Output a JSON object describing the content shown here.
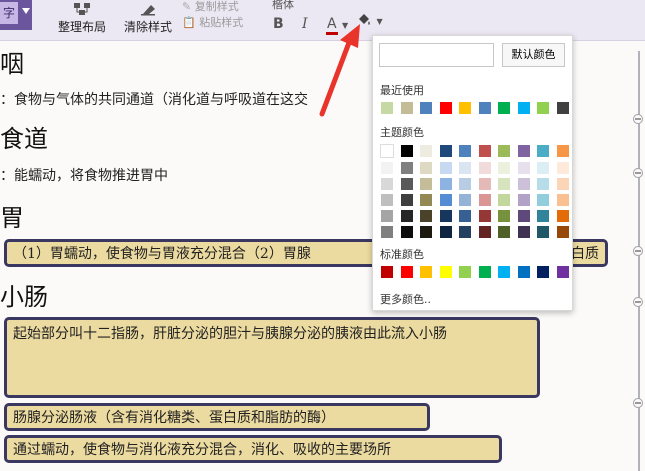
{
  "toolbar": {
    "cut_label": "字",
    "layout_button": "整理布局",
    "clear_style_button": "清除样式",
    "copy_style": "复制样式",
    "paste_style": "粘贴样式",
    "font_name": "楷体",
    "bold": "B",
    "italic": "I",
    "font_color": "A",
    "colors": {
      "purple": "#6b559c",
      "font_color_bar": "#c00000"
    }
  },
  "content": {
    "h1": "咽",
    "line1": "：食物与气体的共同通道（消化道与呼吸道在这交",
    "h2": "食道",
    "line2": "：能蠕动，将食物推进胃中",
    "h3": "胃",
    "box1_a": "（1）胃蠕动，使食物与胃液充分混合（2）胃腺",
    "box1_b": "白质",
    "h4": "小肠",
    "box2": "起始部分叫十二指肠，肝脏分泌的胆汁与胰腺分泌的胰液由此流入小肠",
    "box3": "肠腺分泌肠液（含有消化糖类、蛋白质和脂肪的酶）",
    "box4": "通过蠕动，使食物与消化液充分混合，消化、吸收的主要场所",
    "box_color": "#ecdba0",
    "box_border": "#3a3760"
  },
  "color_picker": {
    "hex_value": "",
    "default_button": "默认颜色",
    "recent_label": "最近使用",
    "theme_label": "主题颜色",
    "standard_label": "标准颜色",
    "more_colors": "更多颜色..",
    "recent": [
      "#c6d9a4",
      "#c4bc96",
      "#4f81bd",
      "#ff0000",
      "#ffc000",
      "#4f81bd",
      "#00b050",
      "#00b0f0",
      "#92d050",
      "#404040"
    ],
    "theme": [
      [
        "#ffffff",
        "#000000",
        "#eeece1",
        "#1f497d",
        "#4f81bd",
        "#c0504d",
        "#9bbb59",
        "#8064a2",
        "#4bacc6",
        "#f79646"
      ],
      [
        "#f2f2f2",
        "#7f7f7f",
        "#ddd9c3",
        "#c6d9f0",
        "#dbe5f1",
        "#f2dcdb",
        "#ebf1dd",
        "#e5e0ec",
        "#dbeef3",
        "#fdeada"
      ],
      [
        "#d8d8d8",
        "#595959",
        "#c4bd97",
        "#8db3e2",
        "#b8cce4",
        "#e5b9b7",
        "#d7e3bc",
        "#ccc1d9",
        "#b7dde8",
        "#fbd5b5"
      ],
      [
        "#bfbfbf",
        "#3f3f3f",
        "#938953",
        "#548dd4",
        "#95b3d7",
        "#d99694",
        "#c3d69b",
        "#b2a2c7",
        "#92cddc",
        "#fac08f"
      ],
      [
        "#a5a5a5",
        "#262626",
        "#494429",
        "#17365d",
        "#366092",
        "#953734",
        "#76923c",
        "#5f497a",
        "#31859b",
        "#e36c09"
      ],
      [
        "#7f7f7f",
        "#0c0c0c",
        "#1d1b10",
        "#0f243e",
        "#244061",
        "#632423",
        "#4f6128",
        "#3f3151",
        "#205867",
        "#974806"
      ]
    ],
    "standard": [
      "#c00000",
      "#ff0000",
      "#ffc000",
      "#ffff00",
      "#92d050",
      "#00b050",
      "#00b0f0",
      "#0070c0",
      "#002060",
      "#7030a0"
    ]
  },
  "annotation": {
    "arrow_color": "#e8342a"
  }
}
